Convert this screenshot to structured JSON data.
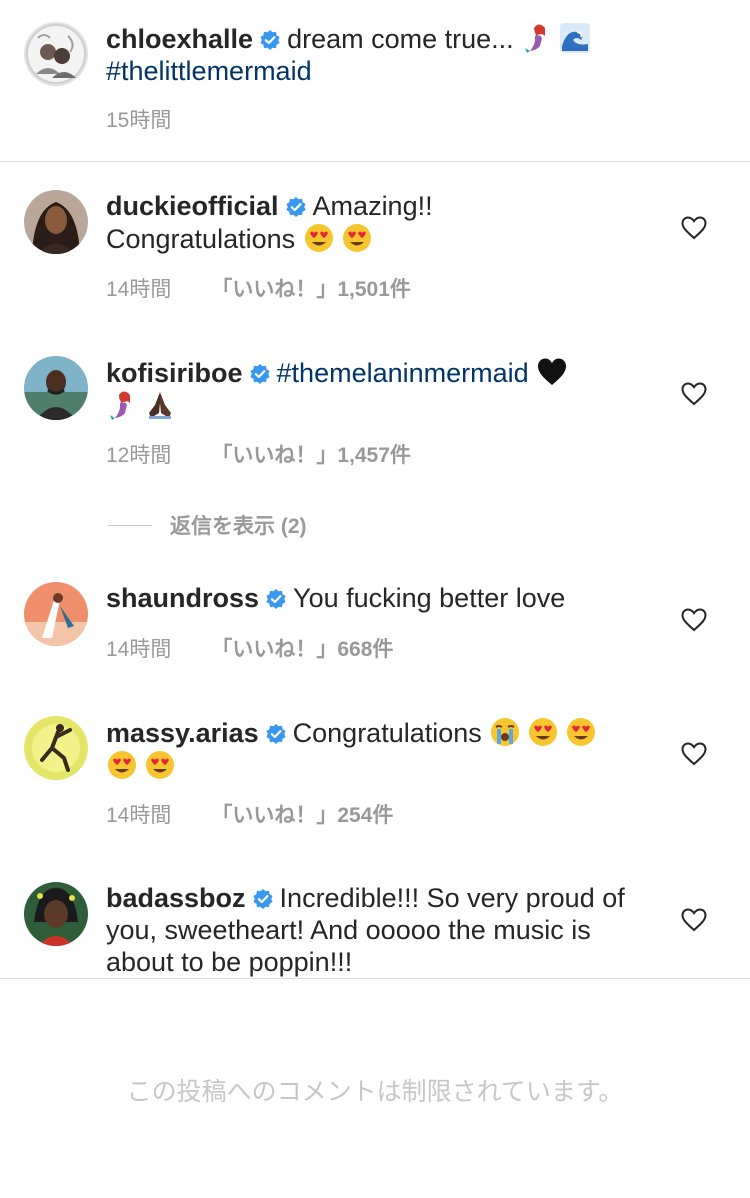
{
  "caption": {
    "username": "chloexhalle",
    "text": "dream come true...",
    "emojis": [
      "mermaid-emoji",
      "wave-emoji"
    ],
    "hashtag": "#thelittlemermaid",
    "time": "15時間"
  },
  "comments": [
    {
      "username": "duckieofficial",
      "text_line1": "Amazing!!",
      "text_line2": "Congratulations",
      "emojis": [
        "heart-eyes-emoji",
        "heart-eyes-emoji"
      ],
      "time": "14時間",
      "likes": "「いいね！」1,501件"
    },
    {
      "username": "kofisiriboe",
      "hashtag": "#themelaninmermaid",
      "emojis": [
        "black-heart-emoji",
        "mermaid-emoji",
        "folded-hands-emoji"
      ],
      "time": "12時間",
      "likes": "「いいね！」1,457件"
    },
    {
      "username": "shaundross",
      "text": "You fucking better love",
      "time": "14時間",
      "likes": "「いいね！」668件"
    },
    {
      "username": "massy.arias",
      "text": "Congratulations",
      "emojis": [
        "crying-emoji",
        "heart-eyes-emoji",
        "heart-eyes-emoji",
        "heart-eyes-emoji",
        "heart-eyes-emoji"
      ],
      "time": "14時間",
      "likes": "「いいね！」254件"
    },
    {
      "username": "badassboz",
      "text": "Incredible!!! So very proud of you, sweetheart! And ooooo the music is about to be poppin!!!"
    }
  ],
  "view_replies": "返信を表示 (2)",
  "footer": {
    "restricted_text": "この投稿へのコメントは制限されています。"
  },
  "colors": {
    "text": "#262626",
    "muted": "#999999",
    "hashtag": "#003569",
    "verified": "#3897f0",
    "divider": "#dbdbdb"
  }
}
